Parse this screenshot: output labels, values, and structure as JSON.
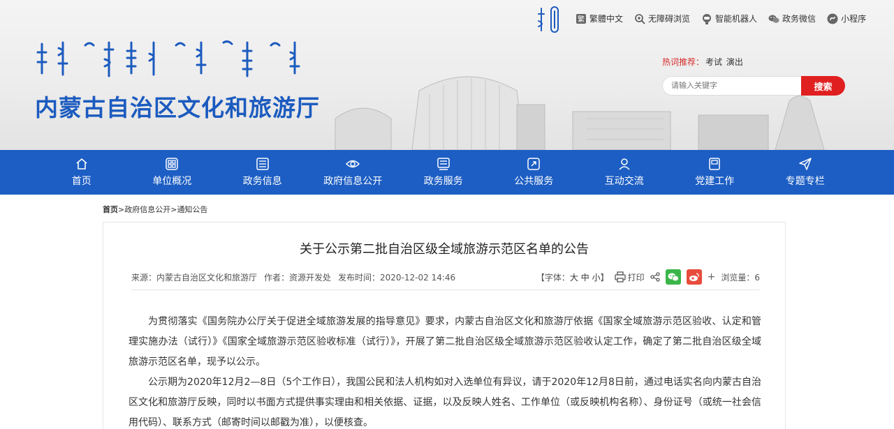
{
  "header": {
    "site_title": "内蒙古自治区文化和旅游厅",
    "tools": [
      {
        "label": "繁體中文",
        "icon": "traditional-chinese-icon"
      },
      {
        "label": "无障碍浏览",
        "icon": "accessibility-icon"
      },
      {
        "label": "智能机器人",
        "icon": "robot-icon"
      },
      {
        "label": "政务微信",
        "icon": "wechat-icon"
      },
      {
        "label": "小程序",
        "icon": "mini-program-icon"
      }
    ],
    "hot_label": "热词推荐：",
    "hot_keywords": [
      "考试",
      "演出"
    ],
    "search_placeholder": "请输入关键字",
    "search_button": "搜索"
  },
  "nav": {
    "items": [
      {
        "label": "首页",
        "icon": "home-icon"
      },
      {
        "label": "单位概况",
        "icon": "grid-icon"
      },
      {
        "label": "政务信息",
        "icon": "news-icon"
      },
      {
        "label": "政府信息公开",
        "icon": "eye-icon"
      },
      {
        "label": "政务服务",
        "icon": "service-icon"
      },
      {
        "label": "公共服务",
        "icon": "public-service-icon"
      },
      {
        "label": "互动交流",
        "icon": "people-icon"
      },
      {
        "label": "党建工作",
        "icon": "party-icon"
      },
      {
        "label": "专题专栏",
        "icon": "send-icon"
      }
    ]
  },
  "breadcrumb": {
    "home": "首页",
    "sep": ">",
    "level1": "政府信息公开",
    "level2": "通知公告"
  },
  "article": {
    "title": "关于公示第二批自治区级全域旅游示范区名单的公告",
    "source": "来源：内蒙古自治区文化和旅游厅",
    "author": "作者：资源开发处",
    "publish_time": "发布时间：2020-12-02 14:46",
    "font_size_prefix": "【字体：",
    "font_sizes": [
      "大",
      "中",
      "小"
    ],
    "font_size_suffix": "】",
    "print_label": "打印",
    "views": "浏览量：6",
    "paragraphs": [
      "为贯彻落实《国务院办公厅关于促进全域旅游发展的指导意见》要求，内蒙古自治区文化和旅游厅依据《国家全域旅游示范区验收、认定和管理实施办法（试行）》《国家全域旅游示范区验收标准（试行）》，开展了第二批自治区级全域旅游示范区验收认定工作，确定了第二批自治区级全域旅游示范区名单，现予以公示。",
      "公示期为2020年12月2—8日（5个工作日），我国公民和法人机构如对入选单位有异议，请于2020年12月8日前，通过电话实名向内蒙古自治区文化和旅游厅反映，同时以书面方式提供事实理由和相关依据、证据，以及反映人姓名、工作单位（或反映机构名称）、身份证号（或统一社会信用代码）、联系方式（邮寄时间以邮戳为准），以便核查。"
    ]
  },
  "colors": {
    "brand_blue": "#1d5ec4",
    "title_blue": "#1c5bbf",
    "search_red": "#e02020",
    "hot_red": "#d42a2a"
  }
}
